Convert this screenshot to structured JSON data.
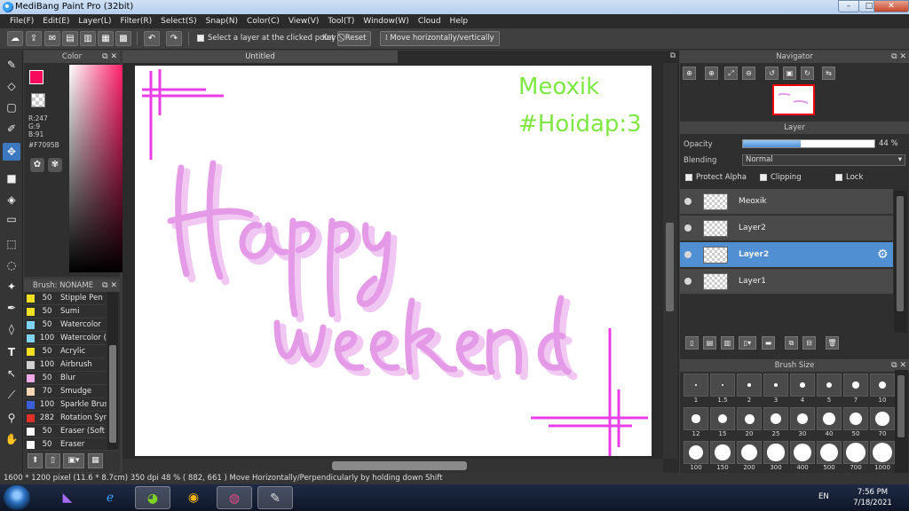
{
  "window": {
    "title": "MediBang Paint Pro (32bit)"
  },
  "menu": [
    "File(F)",
    "Edit(E)",
    "Layer(L)",
    "Filter(R)",
    "Select(S)",
    "Snap(N)",
    "Color(C)",
    "View(V)",
    "Tool(T)",
    "Window(W)",
    "Cloud",
    "Help"
  ],
  "toolbar": {
    "select_layer_label": "Select a layer at the clicked point",
    "key_label": "Key",
    "reset_label": "Reset",
    "move_label": "Move horizontally/vertically"
  },
  "color_panel": {
    "title": "Color",
    "r": "R:247",
    "g": "G:9",
    "b": "B:91",
    "hex": "#F7095B",
    "primary_color": "#f7095b"
  },
  "brush_panel": {
    "title": "Brush: NONAME",
    "brushes": [
      {
        "size": "50",
        "name": "Stipple Pen",
        "color": "#f0e020"
      },
      {
        "size": "50",
        "name": "Sumi",
        "color": "#f0e020"
      },
      {
        "size": "50",
        "name": "Watercolor",
        "color": "#7fd4f5"
      },
      {
        "size": "100",
        "name": "Watercolor (",
        "color": "#7fd4f5"
      },
      {
        "size": "50",
        "name": "Acrylic",
        "color": "#f0e020"
      },
      {
        "size": "100",
        "name": "Airbrush",
        "color": "#d0d0d0"
      },
      {
        "size": "50",
        "name": "Blur",
        "color": "#f2a8e6"
      },
      {
        "size": "70",
        "name": "Smudge",
        "color": "#f5d7b8"
      },
      {
        "size": "100",
        "name": "Sparkle Brus",
        "color": "#3a5fd8"
      },
      {
        "size": "282",
        "name": "Rotation Syr",
        "color": "#e0302a"
      },
      {
        "size": "50",
        "name": "Eraser (Soft",
        "color": "#ffffff"
      },
      {
        "size": "50",
        "name": "Eraser",
        "color": "#ffffff"
      }
    ]
  },
  "canvas": {
    "tab": "Untitled",
    "text_line1": "Meoxik",
    "text_line2": "#Hoidap:3",
    "text_color": "#7ee843",
    "lettering_color": "#e59ae8",
    "frame_color": "#e93de8"
  },
  "navigator": {
    "title": "Navigator"
  },
  "layer_panel": {
    "title": "Layer",
    "opacity_label": "Opacity",
    "opacity_value": "44 %",
    "opacity": 0.44,
    "blending_label": "Blending",
    "blending_value": "Normal",
    "protect_alpha": "Protect Alpha",
    "clipping": "Clipping",
    "lock": "Lock",
    "layers": [
      {
        "name": "Meoxik",
        "selected": false
      },
      {
        "name": "Layer2",
        "selected": false
      },
      {
        "name": "Layer2",
        "selected": true
      },
      {
        "name": "Layer1",
        "selected": false
      }
    ]
  },
  "brush_size": {
    "title": "Brush Size",
    "sizes": [
      "1",
      "1.5",
      "2",
      "3",
      "4",
      "5",
      "7",
      "10",
      "12",
      "15",
      "20",
      "25",
      "30",
      "40",
      "50",
      "70",
      "100",
      "150",
      "200",
      "300",
      "400",
      "500",
      "700",
      "1000"
    ]
  },
  "status": {
    "text": "1600 * 1200 pixel   (11.6 * 8.7cm)   350 dpi   48 %   ( 882, 661 )   Move Horizontally/Perpendicularly by holding down Shift"
  },
  "taskbar": {
    "lang": "EN",
    "time": "7:56 PM",
    "date": "7/18/2021"
  }
}
